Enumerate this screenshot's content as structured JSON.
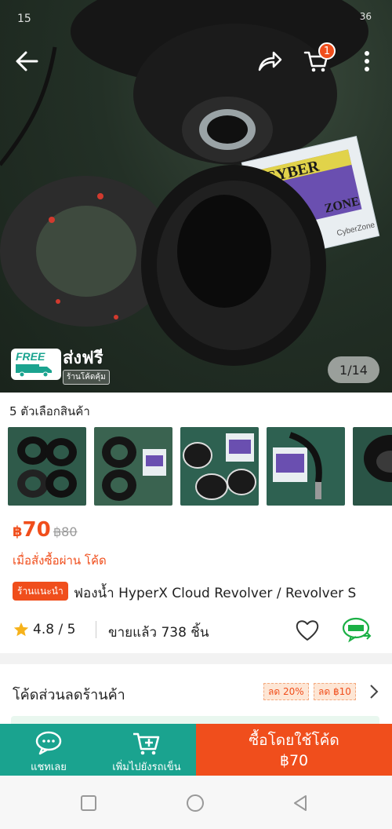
{
  "status_bar": {
    "time": "15",
    "right": "36"
  },
  "header": {
    "back_icon": "back-arrow-icon",
    "share_icon": "share-icon",
    "cart_icon": "cart-icon",
    "cart_count": "1",
    "more_icon": "more-vertical-icon"
  },
  "hero": {
    "free_shipping_en": "FREE",
    "free_shipping_th": "ส่งฟรี",
    "free_shipping_sub": "ร้านโค้ดคุ้ม",
    "image_counter": "1/14",
    "sticker_text_1": "CYBER",
    "sticker_text_2": "ZONE",
    "sticker_text_3": "CyberZone"
  },
  "options": {
    "label": "5 ตัวเลือกสินค้า"
  },
  "product": {
    "price_currency": "฿",
    "price": "70",
    "old_price": "฿80",
    "code_note": "เมื่อสั่งซื้อผ่าน โค้ด",
    "recommend_badge": "ร้านแนะนำ",
    "title": "ฟองน้ำ HyperX Cloud Revolver / Revolver S",
    "rating": "4.8 / 5",
    "sold": "ขายแล้ว 738 ชิ้น"
  },
  "coupons": {
    "label": "โค้ดส่วนลดร้านค้า",
    "tags": [
      "ลด 20%",
      "ลด ฿10"
    ]
  },
  "action_bar": {
    "chat_label": "แชทเลย",
    "add_cart_label": "เพิ่มไปยังรถเข็น",
    "buy_label": "ซื้อโดยใช้โค้ด",
    "buy_price": "฿70"
  },
  "colors": {
    "accent_orange": "#f04e1c",
    "accent_teal": "#1aa38f"
  }
}
